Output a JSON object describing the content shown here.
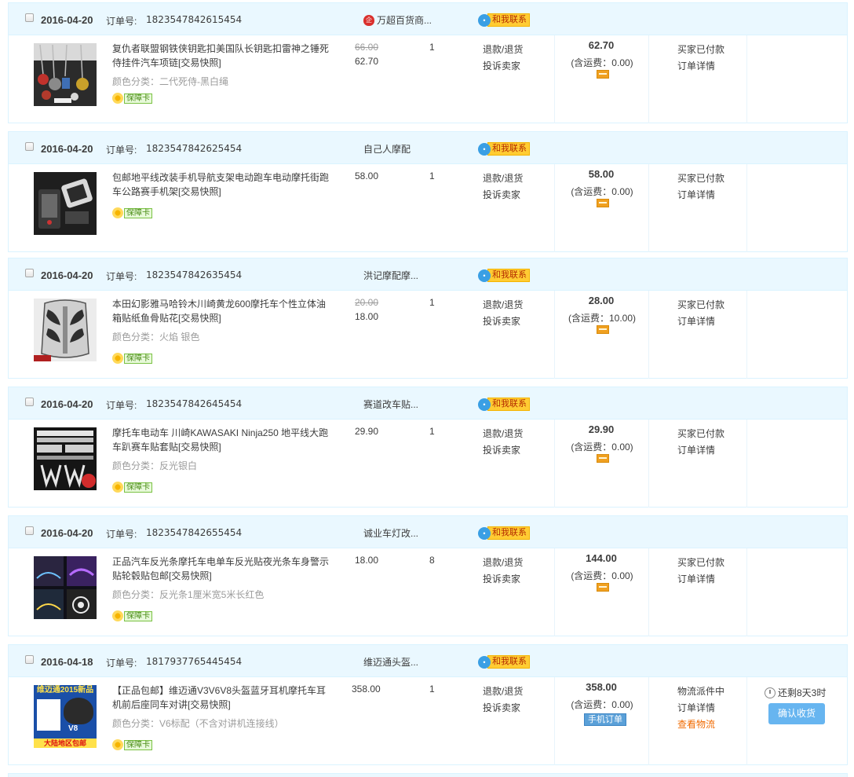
{
  "labels": {
    "order_no": "订单号:",
    "contact": "和我联系",
    "snapshot": "[交易快照]",
    "guarantee": "保障卡",
    "refund": "退款/退货",
    "complain": "投诉卖家",
    "order_detail": "订单详情",
    "view_logistics": "查看物流",
    "confirm_receipt": "确认收货",
    "remaining": "还剩8天3时",
    "mobile_order": "手机订单"
  },
  "orders": [
    {
      "date": "2016-04-20",
      "order_no": "1823547842615454",
      "shop": "万超百货商...",
      "shop_badge": "企",
      "title": "复仇者联盟钢铁侠钥匙扣美国队长钥匙扣雷神之锤死侍挂件汽车项链",
      "sku": "颜色分类：二代死侍-黑白绳",
      "price_original": "66.00",
      "price": "62.70",
      "qty": "1",
      "total": "62.70",
      "freight": "(含运费：0.00)",
      "status": "买家已付款"
    },
    {
      "date": "2016-04-20",
      "order_no": "1823547842625454",
      "shop": "自己人摩配",
      "title": "包邮地平线改装手机导航支架电动跑车电动摩托街跑车公路赛手机架",
      "sku": "",
      "price": "58.00",
      "qty": "1",
      "total": "58.00",
      "freight": "(含运费：0.00)",
      "status": "买家已付款"
    },
    {
      "date": "2016-04-20",
      "order_no": "1823547842635454",
      "shop": "洪记摩配摩...",
      "title": "本田幻影雅马哈铃木川崎黄龙600摩托车个性立体油箱贴纸鱼骨贴花",
      "sku": "颜色分类：火焰 银色",
      "price_original": "20.00",
      "price": "18.00",
      "qty": "1",
      "total": "28.00",
      "freight": "(含运费：10.00)",
      "status": "买家已付款"
    },
    {
      "date": "2016-04-20",
      "order_no": "1823547842645454",
      "shop": "赛道改车贴...",
      "title": "摩托车电动车 川崎KAWASAKI Ninja250 地平线大跑车趴赛车贴套贴",
      "sku": "颜色分类：反光银白",
      "price": "29.90",
      "qty": "1",
      "total": "29.90",
      "freight": "(含运费：0.00)",
      "status": "买家已付款"
    },
    {
      "date": "2016-04-20",
      "order_no": "1823547842655454",
      "shop": "诚业车灯改...",
      "title": "正品汽车反光条摩托车电单车反光贴夜光条车身警示贴轮毂贴包邮",
      "sku": "颜色分类：反光条1厘米宽5米长红色",
      "price": "18.00",
      "qty": "8",
      "total": "144.00",
      "freight": "(含运费：0.00)",
      "status": "买家已付款"
    },
    {
      "date": "2016-04-18",
      "order_no": "1817937765445454",
      "shop": "维迈通头盔...",
      "title": "【正品包邮】维迈通V3V6V8头盔蓝牙耳机摩托车耳机前后座同车对讲",
      "sku": "颜色分类：V6标配（不含对讲机连接线）",
      "price": "358.00",
      "qty": "1",
      "total": "358.00",
      "freight": "(含运费：0.00)",
      "status": "物流派件中",
      "thumb_text": [
        "维迈通2015新品",
        "V8",
        "大陆地区包邮"
      ]
    }
  ]
}
